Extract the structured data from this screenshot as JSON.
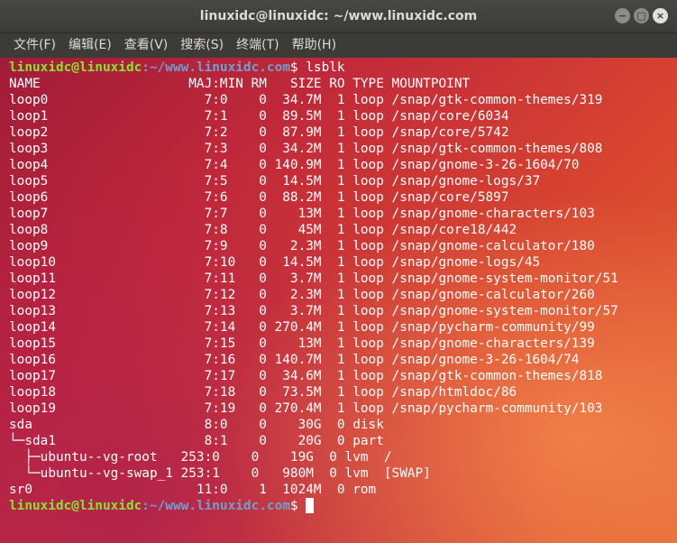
{
  "window": {
    "title": "linuxidc@linuxidc: ~/www.linuxidc.com",
    "buttons": {
      "minimize": "−",
      "maximize": "□",
      "close": "×"
    }
  },
  "menu": [
    "文件(F)",
    "编辑(E)",
    "查看(V)",
    "搜索(S)",
    "终端(T)",
    "帮助(H)"
  ],
  "prompt": {
    "user": "linuxidc@linuxidc",
    "path": ":~/www.linuxidc.com",
    "symbol": "$ ",
    "command": "lsblk"
  },
  "lines": [
    "NAME                   MAJ:MIN RM   SIZE RO TYPE MOUNTPOINT",
    "loop0                    7:0    0  34.7M  1 loop /snap/gtk-common-themes/319",
    "loop1                    7:1    0  89.5M  1 loop /snap/core/6034",
    "loop2                    7:2    0  87.9M  1 loop /snap/core/5742",
    "loop3                    7:3    0  34.2M  1 loop /snap/gtk-common-themes/808",
    "loop4                    7:4    0 140.9M  1 loop /snap/gnome-3-26-1604/70",
    "loop5                    7:5    0  14.5M  1 loop /snap/gnome-logs/37",
    "loop6                    7:6    0  88.2M  1 loop /snap/core/5897",
    "loop7                    7:7    0    13M  1 loop /snap/gnome-characters/103",
    "loop8                    7:8    0    45M  1 loop /snap/core18/442",
    "loop9                    7:9    0   2.3M  1 loop /snap/gnome-calculator/180",
    "loop10                   7:10   0  14.5M  1 loop /snap/gnome-logs/45",
    "loop11                   7:11   0   3.7M  1 loop /snap/gnome-system-monitor/51",
    "loop12                   7:12   0   2.3M  1 loop /snap/gnome-calculator/260",
    "loop13                   7:13   0   3.7M  1 loop /snap/gnome-system-monitor/57",
    "loop14                   7:14   0 270.4M  1 loop /snap/pycharm-community/99",
    "loop15                   7:15   0    13M  1 loop /snap/gnome-characters/139",
    "loop16                   7:16   0 140.7M  1 loop /snap/gnome-3-26-1604/74",
    "loop17                   7:17   0  34.6M  1 loop /snap/gtk-common-themes/818",
    "loop18                   7:18   0  73.5M  1 loop /snap/htmldoc/86",
    "loop19                   7:19   0 270.4M  1 loop /snap/pycharm-community/103",
    "sda                      8:0    0    30G  0 disk",
    "└─sda1                   8:1    0    20G  0 part",
    "  ├─ubuntu--vg-root   253:0    0    19G  0 lvm  /",
    "  └─ubuntu--vg-swap_1 253:1    0   980M  0 lvm  [SWAP]",
    "sr0                     11:0    1  1024M  0 rom"
  ]
}
